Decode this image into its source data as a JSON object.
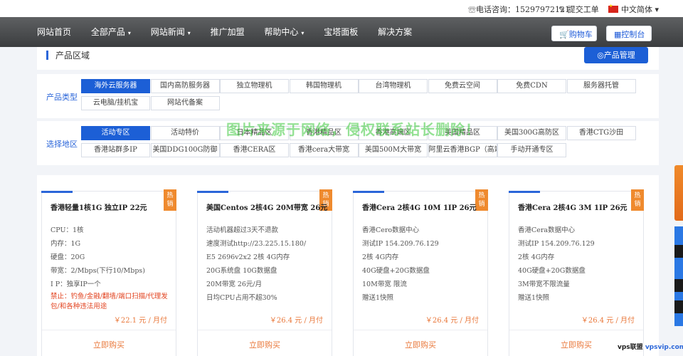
{
  "topbar": {
    "phone": "☏电话咨询：15297972121",
    "ticket": "✎ 提交工单",
    "language": "中文简体 ▾"
  },
  "nav": {
    "items": [
      "网站首页",
      "全部产品",
      "网站新闻",
      "推广加盟",
      "帮助中心",
      "宝塔面板",
      "解决方案"
    ],
    "cart": "🛒购物车",
    "console": "▦控制台"
  },
  "area": {
    "title": "产品区域",
    "manage_button": "产品管理"
  },
  "filter_type": {
    "label": "产品类型",
    "options": [
      "海外云服务器",
      "国内高防服务器",
      "独立物理机",
      "韩国物理机",
      "台湾物理机",
      "免费云空间",
      "免费CDN",
      "服务器托管",
      "云电脑/挂机宝",
      "网站代备案"
    ],
    "active": "海外云服务器"
  },
  "filter_region": {
    "label": "选择地区",
    "options": [
      "活动专区",
      "活动特价",
      "日本精品区",
      "香港精品区",
      "香港高端区",
      "美国精品区",
      "美国300G高防区",
      "香港CTG沙田",
      "香港站群多IP",
      "美国DDG100G防御",
      "香港CERA区",
      "香港cera大带宽",
      "美国500M大带宽",
      "阿里云香港BGP（高端）",
      "手动开通专区"
    ],
    "active": "活动专区"
  },
  "watermark": "图片来源于网络，侵权联系站长删除！",
  "products": [
    {
      "badge": "热销",
      "name": "香港轻量1核1G 独立IP 22元",
      "specs": [
        "CPU：1核",
        "内存：1G",
        "硬盘：20G",
        "带宽：2/Mbps(下行10/Mbps)",
        "I  P：独享IP一个"
      ],
      "warning": "禁止：钓鱼/金融/翻墙/端口扫描/代理发包/和各种违法用途",
      "price": "￥22.1 元 / 月付",
      "buy": "立即购买"
    },
    {
      "badge": "热销",
      "name": "美国Centos 2核4G 20M带宽 26元",
      "specs": [
        "活动机器超过3天不退款",
        "速度测试http://23.225.15.180/",
        "E5 2696v2x2 2核 4G内存",
        "20G系统盘 10G数据盘",
        "20M带宽 26元/月",
        "日均CPU占用不超30%"
      ],
      "warning": "",
      "price": "￥26.4 元 / 月付",
      "buy": "立即购买"
    },
    {
      "badge": "热销",
      "name": "香港Cera 2核4G 10M 1IP 26元",
      "specs": [
        "香港Cero数据中心",
        "测试IP 154.209.76.129",
        "2核 4G内存",
        "40G硬盘+20G数据盘",
        "10M带宽 限流",
        "赠送1快照"
      ],
      "warning": "",
      "price": "￥26.4 元 / 月付",
      "buy": "立即购买"
    },
    {
      "badge": "热销",
      "name": "香港Cera 2核4G 3M 1IP 26元",
      "specs": [
        "香港Cera数据中心",
        "测试IP 154.209.76.129",
        "2核 4G内存",
        "40G硬盘+20G数据盘",
        "3M带宽不限流量",
        "赠送1快照"
      ],
      "warning": "",
      "price": "￥26.4 元 / 月付",
      "buy": "立即购买"
    }
  ],
  "brand": {
    "part1": "vps联盟",
    "part2": "vpsvip.com"
  }
}
